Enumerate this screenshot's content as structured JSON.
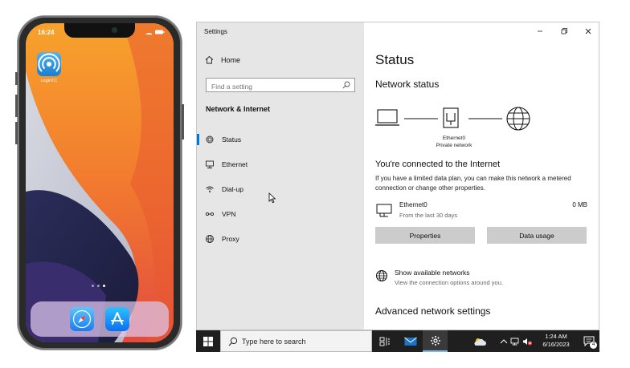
{
  "phone": {
    "time": "16:24",
    "app_label": "LoginTC",
    "page_dots": 3,
    "active_dot": 3
  },
  "settings": {
    "window_title": "Settings",
    "sidebar": {
      "home_label": "Home",
      "search_placeholder": "Find a setting",
      "section_header": "Network & Internet",
      "items": [
        {
          "label": "Status",
          "icon": "status-icon",
          "active": true
        },
        {
          "label": "Ethernet",
          "icon": "ethernet-icon",
          "active": false
        },
        {
          "label": "Dial-up",
          "icon": "dialup-icon",
          "active": false
        },
        {
          "label": "VPN",
          "icon": "vpn-icon",
          "active": false
        },
        {
          "label": "Proxy",
          "icon": "globe-icon",
          "active": false
        }
      ]
    },
    "main": {
      "title": "Status",
      "network_status_heading": "Network status",
      "adapter_name": "Ethernet0",
      "adapter_type": "Private network",
      "connected_heading": "You're connected to the Internet",
      "description": "If you have a limited data plan, you can make this network a metered connection or change other properties.",
      "ethernet_row": {
        "name": "Ethernet0",
        "period": "From the last 30 days",
        "usage": "0 MB"
      },
      "properties_button": "Properties",
      "data_usage_button": "Data usage",
      "show_networks_title": "Show available networks",
      "show_networks_subtitle": "View the connection options around you.",
      "advanced_heading": "Advanced network settings"
    }
  },
  "taskbar": {
    "search_placeholder": "Type here to search",
    "time": "1:24 AM",
    "date": "6/16/2023",
    "notification_count": "4"
  },
  "colors": {
    "accent": "#0078d7",
    "sidebar_bg": "#e6e6e6",
    "taskbar_bg": "#1f1f1f",
    "button_bg": "#cccccc"
  }
}
